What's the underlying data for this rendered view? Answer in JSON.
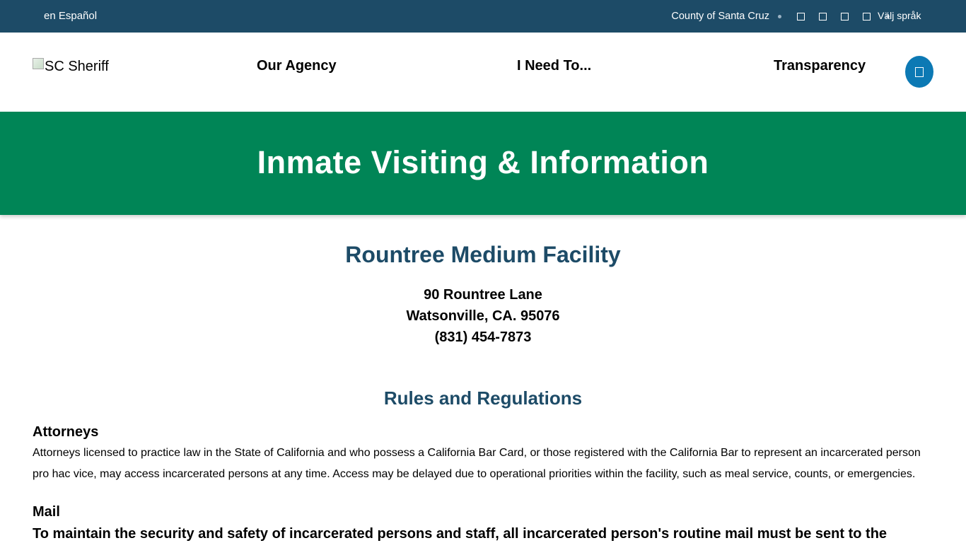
{
  "topbar": {
    "language_link": "en Español",
    "county_link": "County of Santa Cruz",
    "social_icons": [
      "facebook-icon",
      "twitter-icon",
      "instagram-icon",
      "youtube-icon"
    ],
    "translate_label": "Välj språk"
  },
  "header": {
    "logo_alt": "SC Sheriff",
    "nav": [
      "Our Agency",
      "I Need To...",
      "Transparency"
    ],
    "search_icon": "search-icon"
  },
  "banner": {
    "title": "Inmate Visiting & Information"
  },
  "main": {
    "facility_name": "Rountree Medium Facility",
    "address_line1": "90 Rountree Lane",
    "address_line2": "Watsonville, CA. 95076",
    "phone": "(831) 454-7873",
    "rules_heading": "Rules and Regulations",
    "attorneys_heading": "Attorneys",
    "attorneys_text": "Attorneys licensed to practice law in the State of California and who possess a California Bar Card, or those registered with the California Bar to represent an incarcerated person pro hac vice, may access incarcerated persons at any time. Access may be delayed due to operational priorities within the facility, such as meal service, counts, or emergencies.",
    "mail_heading": "Mail",
    "mail_text": "To maintain the security and safety of incarcerated persons and staff, all incarcerated person's routine mail must be sent to the"
  },
  "colors": {
    "topbar_bg": "#1d4b67",
    "banner_bg": "#008556",
    "heading_blue": "#1d4b67",
    "search_button": "#0c79b4"
  }
}
